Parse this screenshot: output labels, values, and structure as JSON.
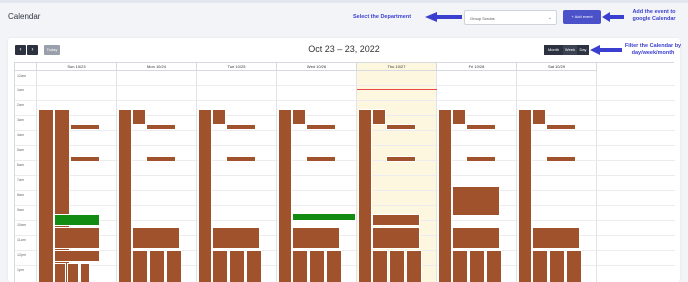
{
  "header": {
    "title": "Calendar",
    "department_select": {
      "value": "Group Scrubs",
      "chevron": "chevron-down-icon"
    },
    "add_button": "+ Add event"
  },
  "annotations": {
    "select_department": "Select the Department",
    "add_event": "Add the event to google Calendar",
    "filter": "Filter the Calendar by day/week/month"
  },
  "toolbar": {
    "prev": "‹",
    "next": "›",
    "today": "Today",
    "range": "Oct 23 – 23, 2022",
    "views": [
      "Month",
      "Week",
      "Day"
    ]
  },
  "days": [
    "Sun 10/23",
    "Mon 10/24",
    "Tue 10/25",
    "Wed 10/26",
    "Thu 10/27",
    "Fri 10/28",
    "Sat 10/29"
  ],
  "times": [
    "12am",
    "1am",
    "2am",
    "3am",
    "4am",
    "5am",
    "6am",
    "7am",
    "8am",
    "9am",
    "10am",
    "11am",
    "12pm",
    "1pm"
  ],
  "colors": {
    "accent": "#4a51c9",
    "event": "#a0522d",
    "event_green": "#128c12",
    "today_bg": "#fdf7df",
    "now_line": "#e84a4a",
    "annotation": "#3b3fcf"
  }
}
